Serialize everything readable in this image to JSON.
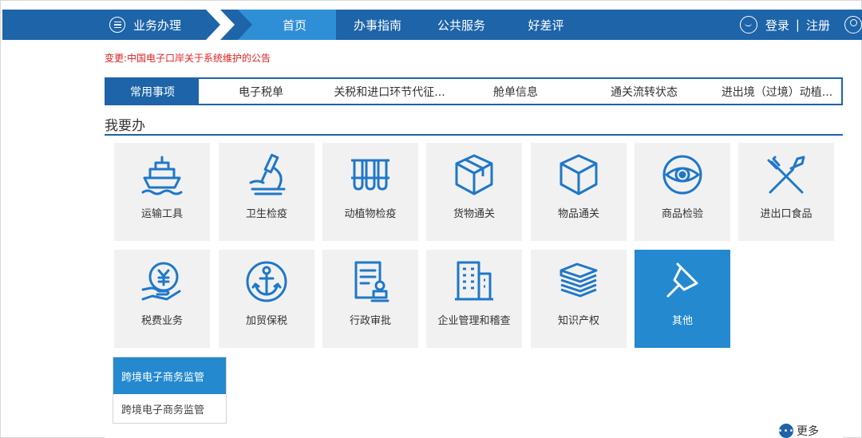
{
  "header": {
    "menu_label": "业务办理",
    "nav": [
      {
        "label": "首页",
        "active": true
      },
      {
        "label": "办事指南",
        "active": false
      },
      {
        "label": "公共服务",
        "active": false
      },
      {
        "label": "好差评",
        "active": false
      }
    ],
    "login": "登录",
    "separator": "|",
    "register": "注册",
    "icons": {
      "menu": "menu-circle-icon",
      "chat": "chat-icon",
      "user": "user-icon"
    }
  },
  "notice": "变更:中国电子口岸关于系统维护的公告",
  "tabs": [
    {
      "label": "常用事项",
      "active": true
    },
    {
      "label": "电子税单",
      "active": false
    },
    {
      "label": "关税和进口环节代征...",
      "active": false
    },
    {
      "label": "舱单信息",
      "active": false
    },
    {
      "label": "通关流转状态",
      "active": false
    },
    {
      "label": "进出境（过境）动植...",
      "active": false
    }
  ],
  "section_title": "我要办",
  "tiles": [
    {
      "label": "运输工具",
      "icon": "ship-icon"
    },
    {
      "label": "卫生检疫",
      "icon": "microscope-icon"
    },
    {
      "label": "动植物检疫",
      "icon": "test-tubes-icon"
    },
    {
      "label": "货物通关",
      "icon": "package-icon"
    },
    {
      "label": "物品通关",
      "icon": "cube-icon"
    },
    {
      "label": "商品检验",
      "icon": "eye-icon"
    },
    {
      "label": "进出口食品",
      "icon": "fork-knife-icon"
    },
    {
      "label": "税费业务",
      "icon": "yuan-hand-icon"
    },
    {
      "label": "加贸保税",
      "icon": "anchor-icon"
    },
    {
      "label": "行政审批",
      "icon": "document-stamp-icon"
    },
    {
      "label": "企业管理和稽查",
      "icon": "building-icon"
    },
    {
      "label": "知识产权",
      "icon": "stack-icon"
    },
    {
      "label": "其他",
      "icon": "pin-icon",
      "active": true
    }
  ],
  "dropdown": {
    "header": "跨境电子商务监管",
    "items": [
      "跨境电子商务监管"
    ]
  },
  "more": "更多",
  "colors": {
    "primary": "#1d64a8",
    "accent": "#2489cf",
    "notice": "#e02020",
    "tile_bg": "#f1f1f1"
  }
}
